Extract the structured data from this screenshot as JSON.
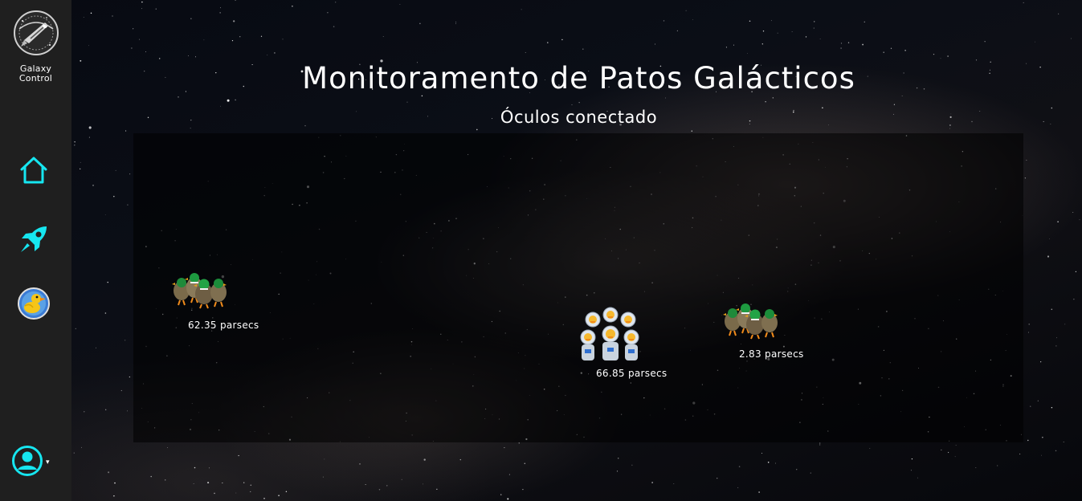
{
  "app": {
    "brand_name_line1": "Galaxy",
    "brand_name_line2": "Control"
  },
  "sidebar": {
    "items": [
      {
        "id": "home",
        "icon": "home-icon"
      },
      {
        "id": "rocket",
        "icon": "rocket-icon"
      },
      {
        "id": "duck",
        "icon": "duck-icon"
      }
    ],
    "user_menu": {
      "icon": "user-circle-icon",
      "caret": "▾"
    }
  },
  "main": {
    "title": "Monitoramento de Patos Galácticos",
    "subtitle": "Óculos conectado"
  },
  "radar": {
    "groups": [
      {
        "type": "green-mallard-flock",
        "icon": "mallard-ducks-icon",
        "distance": "62.35 parsecs"
      },
      {
        "type": "astronaut-duck-squad",
        "icon": "astronaut-ducks-icon",
        "distance": "66.85 parsecs"
      },
      {
        "type": "green-mallard-flock",
        "icon": "mallard-ducks-icon",
        "distance": "2.83 parsecs"
      }
    ]
  },
  "colors": {
    "sidebar_bg": "#1f1f1f",
    "accent_cyan": "#16e6f0",
    "text": "#ffffff"
  }
}
